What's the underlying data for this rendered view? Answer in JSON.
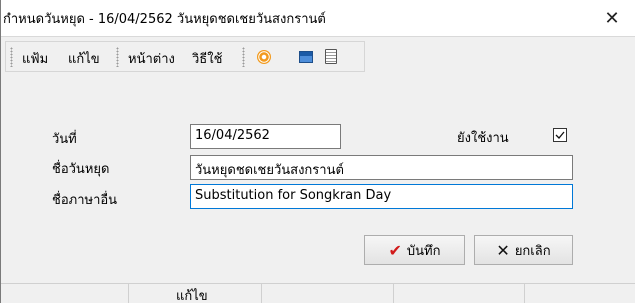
{
  "window": {
    "title": "กำหนดวันหยุด - 16/04/2562 วันหยุดชดเชยวันสงกรานต์",
    "close_glyph": "✕"
  },
  "toolbar": {
    "menu_file": "แฟ้ม",
    "menu_edit": "แก้ไข",
    "menu_window": "หน้าต่าง",
    "menu_help": "วิธีใช้",
    "icons": [
      "target-icon",
      "calculator-icon",
      "clipboard-icon"
    ]
  },
  "form": {
    "date_label": "วันที่",
    "date_value": "16/04/2562",
    "active_label": "ยังใช้งาน",
    "active_checked": true,
    "holiday_name_label": "ชื่อวันหยุด",
    "holiday_name_value": "วันหยุดชดเชยวันสงกรานต์",
    "other_lang_label": "ชื่อภาษาอื่น",
    "other_lang_value": "Substitution for Songkran Day"
  },
  "buttons": {
    "save_label": "บันทึก",
    "save_icon": "✔",
    "cancel_label": "ยกเลิก",
    "cancel_icon": "✕"
  },
  "footer": {
    "status_label": "แก้ไข"
  }
}
